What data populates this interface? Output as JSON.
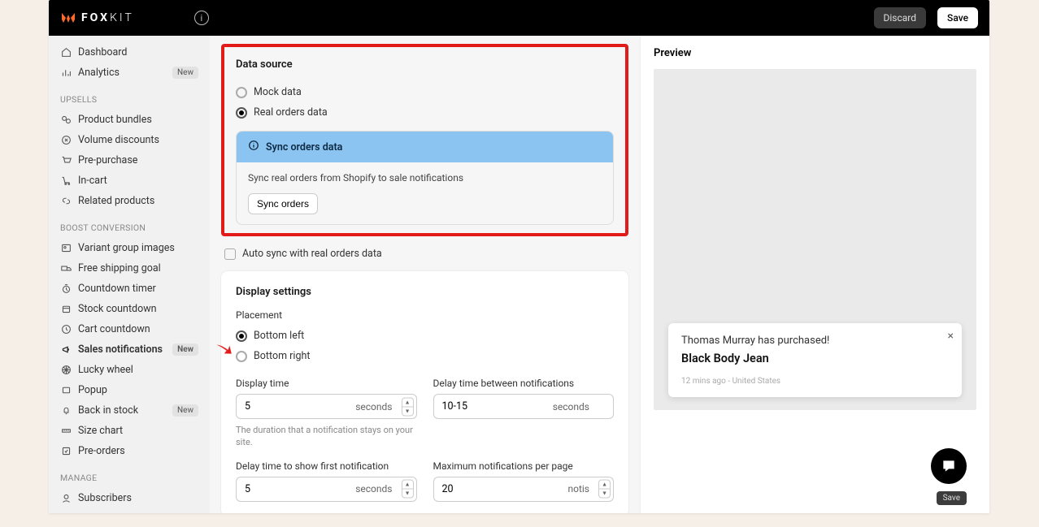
{
  "brand": {
    "text1": "FOX",
    "text2": "KIT"
  },
  "topbar": {
    "discard": "Discard",
    "save": "Save"
  },
  "sidebar": {
    "dashboard": "Dashboard",
    "analytics": "Analytics",
    "analytics_badge": "New",
    "section_upsells": "UPSELLS",
    "product_bundles": "Product bundles",
    "volume_discounts": "Volume discounts",
    "pre_purchase": "Pre-purchase",
    "in_cart": "In-cart",
    "related_products": "Related products",
    "section_boost": "BOOST CONVERSION",
    "variant_group": "Variant group images",
    "free_shipping": "Free shipping goal",
    "countdown_timer": "Countdown timer",
    "stock_countdown": "Stock countdown",
    "cart_countdown": "Cart countdown",
    "sales_notifications": "Sales notifications",
    "sales_badge": "New",
    "lucky_wheel": "Lucky wheel",
    "popup": "Popup",
    "back_in_stock": "Back in stock",
    "back_badge": "New",
    "size_chart": "Size chart",
    "pre_orders": "Pre-orders",
    "section_manage": "MANAGE",
    "subscribers": "Subscribers"
  },
  "datasource": {
    "title": "Data source",
    "mock": "Mock data",
    "real": "Real orders data",
    "sync_title": "Sync orders data",
    "sync_desc": "Sync real orders from Shopify to sale notifications",
    "sync_btn": "Sync orders",
    "autosync": "Auto sync with real orders data"
  },
  "display": {
    "title": "Display settings",
    "placement_label": "Placement",
    "bottom_left": "Bottom left",
    "bottom_right": "Bottom right",
    "display_time_label": "Display time",
    "display_time_value": "5",
    "seconds": "seconds",
    "display_time_help": "The duration that a notification stays on your site.",
    "delay_between_label": "Delay time between notifications",
    "delay_between_value": "10-15",
    "delay_first_label": "Delay time to show first notification",
    "delay_first_value": "5",
    "max_label": "Maximum notifications per page",
    "max_value": "20",
    "notis": "notis"
  },
  "preview": {
    "title": "Preview",
    "notif_text": "Thomas Murray has purchased!",
    "product": "Black Body Jean",
    "meta": "12 mins ago - United States",
    "close": "×"
  },
  "savetip": "Save"
}
